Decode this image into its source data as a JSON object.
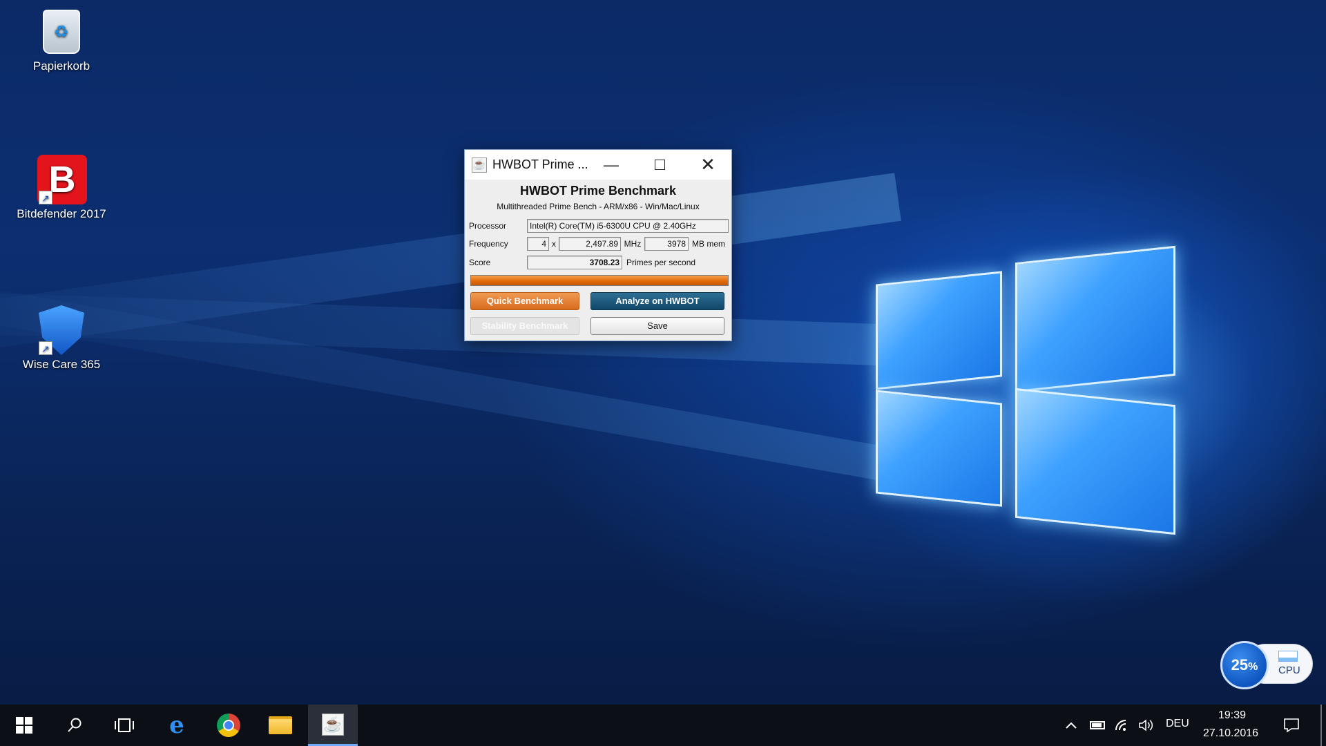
{
  "desktop": {
    "icons": [
      {
        "label": "Papierkorb",
        "icon": "recycle-bin-icon"
      },
      {
        "label": "Bitdefender 2017",
        "icon": "bitdefender-icon"
      },
      {
        "label": "Wise Care 365",
        "icon": "wise-care-icon"
      }
    ]
  },
  "window": {
    "title": "HWBOT Prime ...",
    "heading": "HWBOT Prime Benchmark",
    "subheading": "Multithreaded Prime Bench - ARM/x86 - Win/Mac/Linux",
    "processor_label": "Processor",
    "processor_value": "Intel(R) Core(TM) i5-6300U CPU @ 2.40GHz",
    "frequency_label": "Frequency",
    "threads": "4",
    "x_sep": "x",
    "mhz_value": "2,497.89",
    "mhz_unit": "MHz",
    "mem_value": "3978",
    "mem_unit": "MB mem",
    "score_label": "Score",
    "score_value": "3708.23",
    "score_unit": "Primes per second",
    "progress": 1.0,
    "quick_benchmark": "Quick Benchmark",
    "analyze": "Analyze on HWBOT",
    "stability": "Stability Benchmark",
    "save": "Save"
  },
  "cpu_widget": {
    "percent": "25",
    "percent_sign": "%",
    "label": "CPU"
  },
  "taskbar": {
    "language": "DEU",
    "time": "19:39",
    "date": "27.10.2016"
  },
  "colors": {
    "accent_orange": "#e36c0a",
    "accent_teal": "#0f4769"
  }
}
